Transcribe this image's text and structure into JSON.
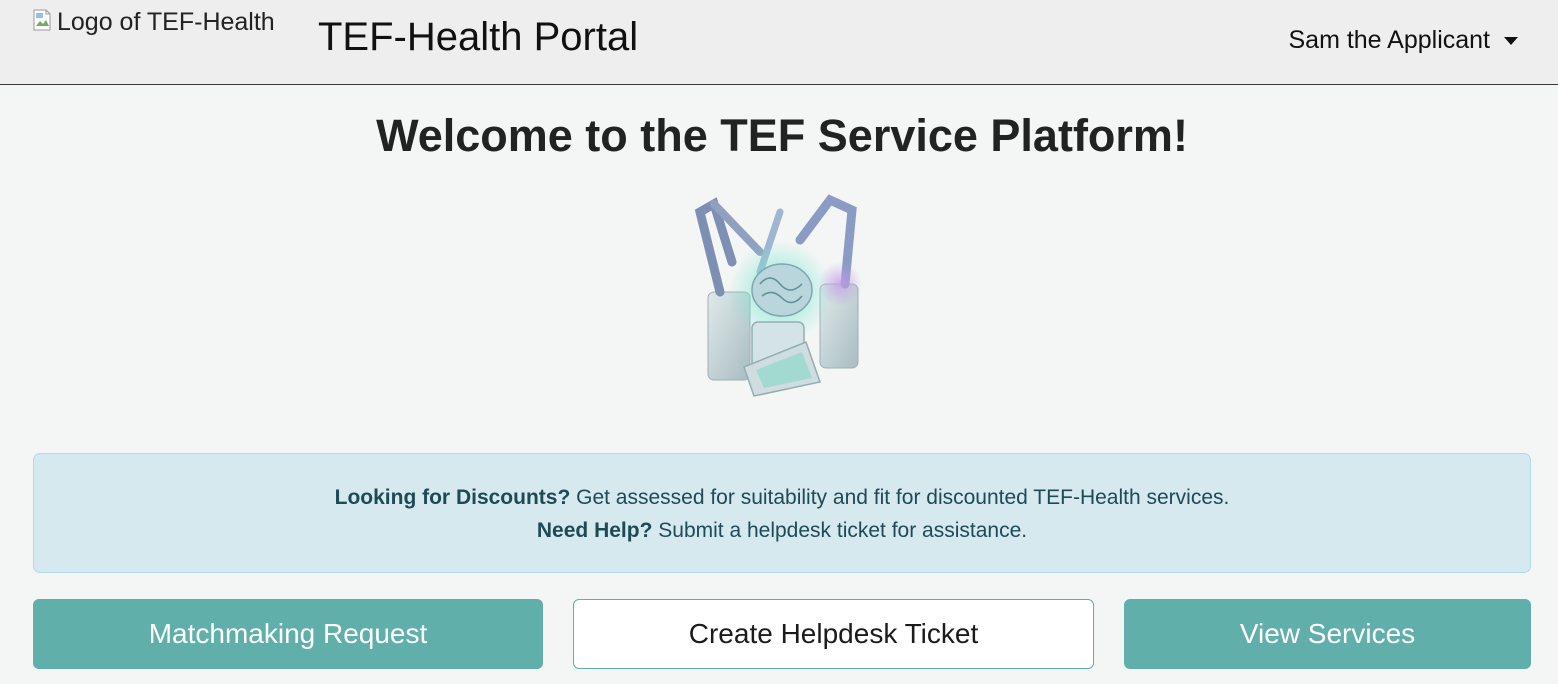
{
  "header": {
    "logo_alt": "Logo of TEF-Health",
    "title": "TEF-Health Portal",
    "user_name": "Sam the Applicant"
  },
  "main": {
    "heading": "Welcome to the TEF Service Platform!",
    "info": {
      "line1_bold": "Looking for Discounts?",
      "line1_text": " Get assessed for suitability and fit for discounted TEF-Health services.",
      "line2_bold": "Need Help?",
      "line2_text": " Submit a helpdesk ticket for assistance."
    },
    "buttons": {
      "matchmaking": "Matchmaking Request",
      "helpdesk": "Create Helpdesk Ticket",
      "services": "View Services"
    }
  },
  "colors": {
    "accent": "#60afaa",
    "alert_bg": "#d5e9ef",
    "navbar_bg": "#eeeeee"
  }
}
